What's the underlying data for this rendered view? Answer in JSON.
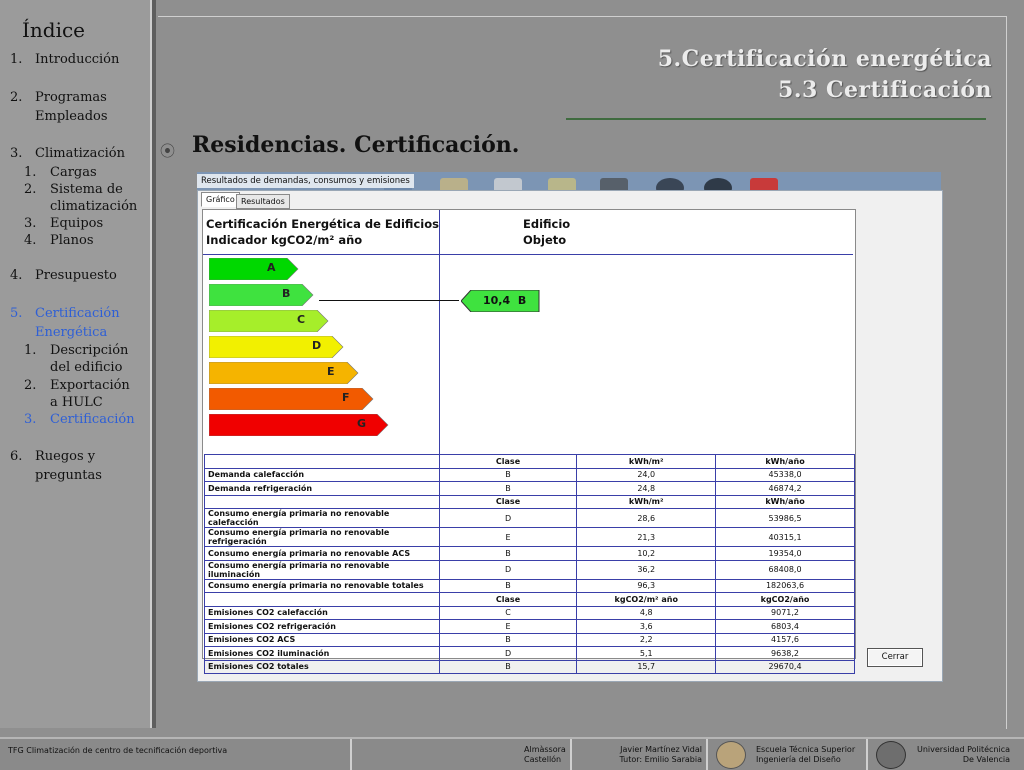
{
  "sidebar": {
    "title": "Índice",
    "items": [
      {
        "num": "1.",
        "label": "Introducción"
      },
      {
        "num": "2.",
        "label": "Programas Empleados"
      },
      {
        "num": "3.",
        "label": "Climatización",
        "sub": [
          {
            "num": "1.",
            "label": "Cargas"
          },
          {
            "num": "2.",
            "label": "Sistema de climatización"
          },
          {
            "num": "3.",
            "label": "Equipos"
          },
          {
            "num": "4.",
            "label": "Planos"
          }
        ]
      },
      {
        "num": "4.",
        "label": "Presupuesto"
      },
      {
        "num": "5.",
        "label": "Certificación Energética",
        "sub": [
          {
            "num": "1.",
            "label": "Descripción del edificio"
          },
          {
            "num": "2.",
            "label": "Exportación a HULC"
          },
          {
            "num": "3.",
            "label": "Certificación"
          }
        ]
      },
      {
        "num": "6.",
        "label": "Ruegos y preguntas"
      }
    ]
  },
  "slide": {
    "title_line1": "5.Certificación energética",
    "title_line2": "5.3 Certificación",
    "heading": "Residencias. Certificación.",
    "bullet": "⦿"
  },
  "window": {
    "title": "Resultados de demandas, consumos y emisiones",
    "tabs": [
      "Gráfico",
      "Resultados"
    ],
    "header_left_line1": "Certificación Energética de Edificios",
    "header_left_line2": "Indicador kgCO2/m² año",
    "header_right_line1": "Edificio",
    "header_right_line2": "Objeto",
    "scale": [
      {
        "letter": "A",
        "color": "#00d800"
      },
      {
        "letter": "B",
        "color": "#3fe23f"
      },
      {
        "letter": "C",
        "color": "#a6ee2a"
      },
      {
        "letter": "D",
        "color": "#f2f000"
      },
      {
        "letter": "E",
        "color": "#f5b400"
      },
      {
        "letter": "F",
        "color": "#f25a00"
      },
      {
        "letter": "G",
        "color": "#f00000"
      }
    ],
    "indicator": {
      "value": "10,4",
      "letter": "B",
      "color": "#3fe23f"
    },
    "table": [
      {
        "type": "header",
        "cells": [
          "",
          "Clase",
          "kWh/m²",
          "kWh/año"
        ]
      },
      {
        "cells": [
          "Demanda calefacción",
          "B",
          "24,0",
          "45338,0"
        ]
      },
      {
        "cells": [
          "Demanda refrigeración",
          "B",
          "24,8",
          "46874,2"
        ]
      },
      {
        "type": "header",
        "cells": [
          "",
          "Clase",
          "kWh/m²",
          "kWh/año"
        ]
      },
      {
        "cells": [
          "Consumo energía primaria no renovable calefacción",
          "D",
          "28,6",
          "53986,5"
        ]
      },
      {
        "cells": [
          "Consumo energía primaria no renovable refrigeración",
          "E",
          "21,3",
          "40315,1"
        ]
      },
      {
        "cells": [
          "Consumo energía primaria no renovable ACS",
          "B",
          "10,2",
          "19354,0"
        ]
      },
      {
        "cells": [
          "Consumo energía primaria no renovable iluminación",
          "D",
          "36,2",
          "68408,0"
        ]
      },
      {
        "cells": [
          "Consumo energía primaria no renovable totales",
          "B",
          "96,3",
          "182063,6"
        ]
      },
      {
        "type": "header",
        "cells": [
          "",
          "Clase",
          "kgCO2/m² año",
          "kgCO2/año"
        ]
      },
      {
        "cells": [
          "Emisiones CO2 calefacción",
          "C",
          "4,8",
          "9071,2"
        ]
      },
      {
        "cells": [
          "Emisiones CO2 refrigeración",
          "E",
          "3,6",
          "6803,4"
        ]
      },
      {
        "cells": [
          "Emisiones CO2 ACS",
          "B",
          "2,2",
          "4157,6"
        ]
      },
      {
        "cells": [
          "Emisiones CO2 iluminación",
          "D",
          "5,1",
          "9638,2"
        ]
      },
      {
        "cells": [
          "Emisiones CO2 totales",
          "B",
          "15,7",
          "29670,4"
        ]
      }
    ],
    "close_button": "Cerrar"
  },
  "footer": {
    "project": "TFG Climatización de centro de tecnificación deportiva",
    "location_line1": "Almàssora",
    "location_line2": "Castellón",
    "author_line1": "Javier Martínez Vidal",
    "author_line2": "Tutor: Emilio Sarabia",
    "school_line1": "Escuela Técnica Superior",
    "school_line2": "Ingeniería del Diseño",
    "university_line1": "Universidad Politécnica",
    "university_line2": "De Valencia"
  },
  "colors": {
    "accent_active": "#2e5fd6",
    "table_border": "#3a3fa8",
    "title_underline": "#3f6b3f"
  }
}
